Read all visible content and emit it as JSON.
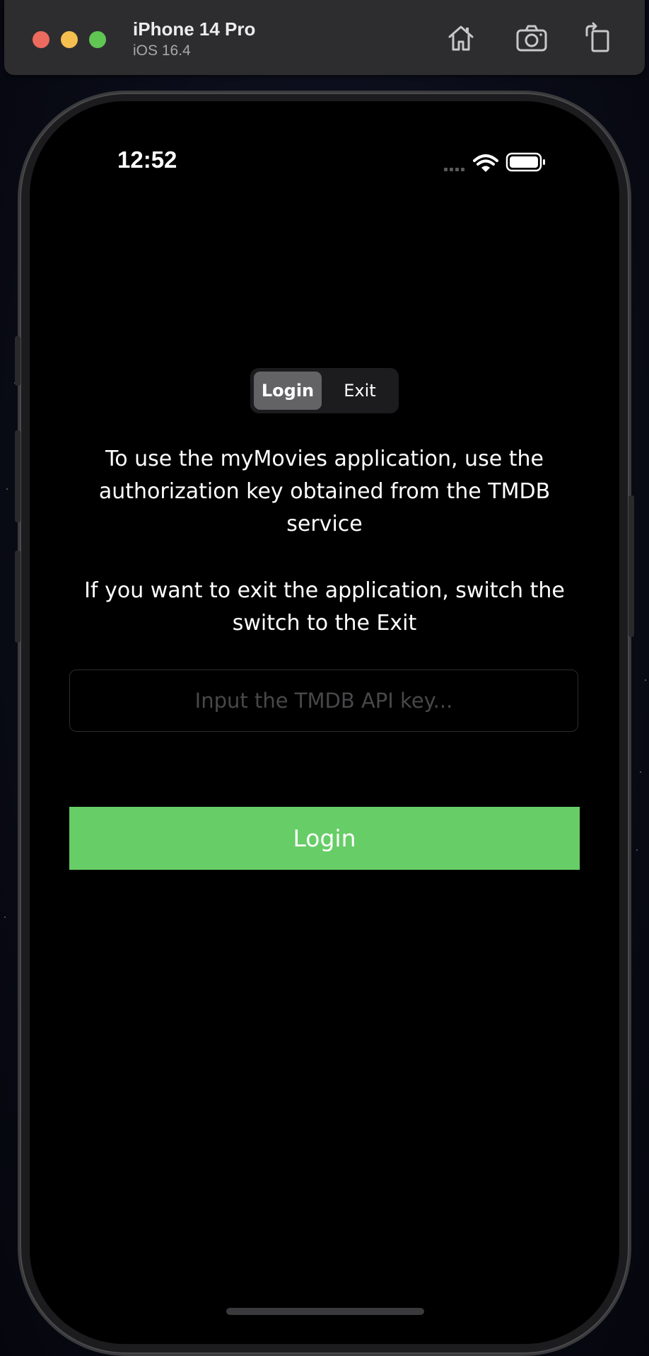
{
  "simulator": {
    "device_name": "iPhone 14 Pro",
    "os_version": "iOS 16.4",
    "toolbar_icons": [
      "home-icon",
      "screenshot-icon",
      "rotate-icon"
    ]
  },
  "status_bar": {
    "time": "12:52",
    "icons": [
      "cellular-icon",
      "wifi-icon",
      "battery-icon"
    ]
  },
  "segmented_control": {
    "options": [
      "Login",
      "Exit"
    ],
    "selected": "Login"
  },
  "info": {
    "paragraph_1": "To use the myMovies application, use the authorization key obtained from the TMDB service",
    "paragraph_2": "If you want to exit the application, switch the switch to the Exit"
  },
  "api_key_field": {
    "value": "",
    "placeholder": "Input the TMDB API key..."
  },
  "login_button": {
    "label": "Login"
  },
  "colors": {
    "accent_green": "#67cd67",
    "screen_background": "#000000",
    "segment_selected": "#636366"
  }
}
